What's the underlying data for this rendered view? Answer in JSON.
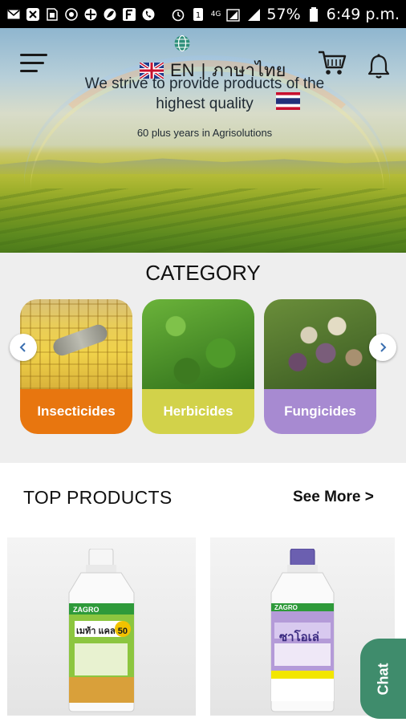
{
  "status_bar": {
    "battery_percent": "57%",
    "time": "6:49 p.m.",
    "network_label": "4G",
    "icons": [
      "mail-icon",
      "chat-bubble-icon",
      "sim-card-icon",
      "whatsapp-icon",
      "grid-app-icon",
      "leaf-app-icon",
      "f-app-icon",
      "phone-call-icon",
      "alarm-icon",
      "vibrate-icon",
      "signal-icon",
      "battery-icon"
    ]
  },
  "header": {
    "language_current": "EN",
    "language_separator": "|",
    "language_alt": "ภาษาไทย"
  },
  "hero": {
    "tagline": "We strive to provide products of the highest quality",
    "subline": "60 plus years in Agrisolutions",
    "slide_index": 1
  },
  "category": {
    "title": "CATEGORY",
    "items": [
      {
        "label": "Insecticides",
        "color": "#e8760f"
      },
      {
        "label": "Herbicides",
        "color": "#d2d24a"
      },
      {
        "label": "Fungicides",
        "color": "#a78ad1"
      }
    ]
  },
  "products": {
    "title": "TOP PRODUCTS",
    "see_more": "See More >",
    "items": [
      {
        "brand": "ZAGRO",
        "name": "เมท้า แคล 50"
      },
      {
        "brand": "ZAGRO",
        "name": "ซาโอเล่"
      }
    ]
  },
  "chat": {
    "label": "Chat",
    "color": "#3f8c6c"
  }
}
